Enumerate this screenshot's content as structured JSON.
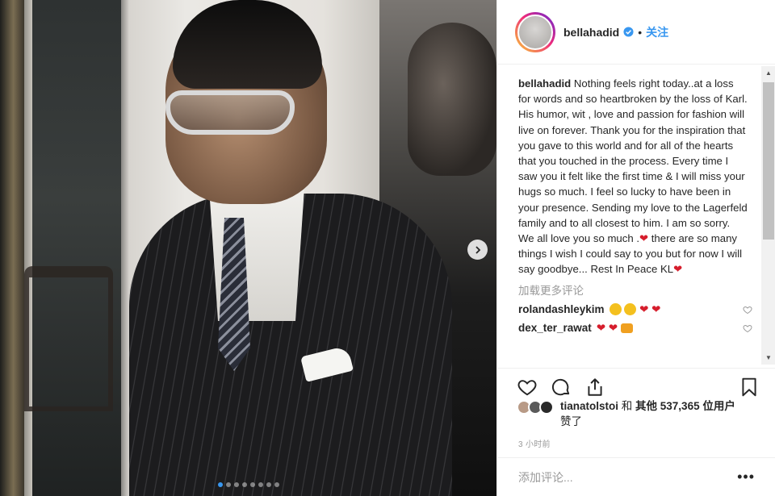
{
  "post": {
    "username": "bellahadid",
    "follow_label": "关注",
    "header_separator": "•",
    "caption_text": "Nothing feels right today..at a loss for words and so heartbroken by the loss of Karl. His humor, wit , love and passion for fashion will live on forever. Thank you for the inspiration that you gave to this world and for all of the hearts that you touched in the process. Every time I saw you it felt like the first time & I will miss your hugs so much. I feel so lucky to have been in your presence. Sending my love to the Lagerfeld family and to all closest to him. I am so sorry. We all love you so much .",
    "caption_text_2": " there are so many things I wish I could say to you but for now I will say goodbye... Rest In Peace KL",
    "heart": "❤",
    "load_more": "加载更多评论",
    "comments": [
      {
        "user": "rolandashleykim"
      },
      {
        "user": "dex_ter_rawat"
      }
    ],
    "likes_user": "tianatolstoi",
    "likes_and": " 和 ",
    "likes_others": "其他 537,365 位用户",
    "likes_suffix": "赞了",
    "time": "3 小时前",
    "add_comment_placeholder": "添加评论...",
    "more_options": "•••",
    "carousel": {
      "count": 8,
      "active_index": 0
    }
  },
  "colors": {
    "accent": "#3897f0",
    "heart": "#d61d2c",
    "muted": "#999999",
    "text": "#262626"
  },
  "icons": [
    "verified-badge-icon",
    "like-icon",
    "comment-icon",
    "share-icon",
    "bookmark-icon",
    "next-arrow-icon",
    "comment-like-icon"
  ]
}
